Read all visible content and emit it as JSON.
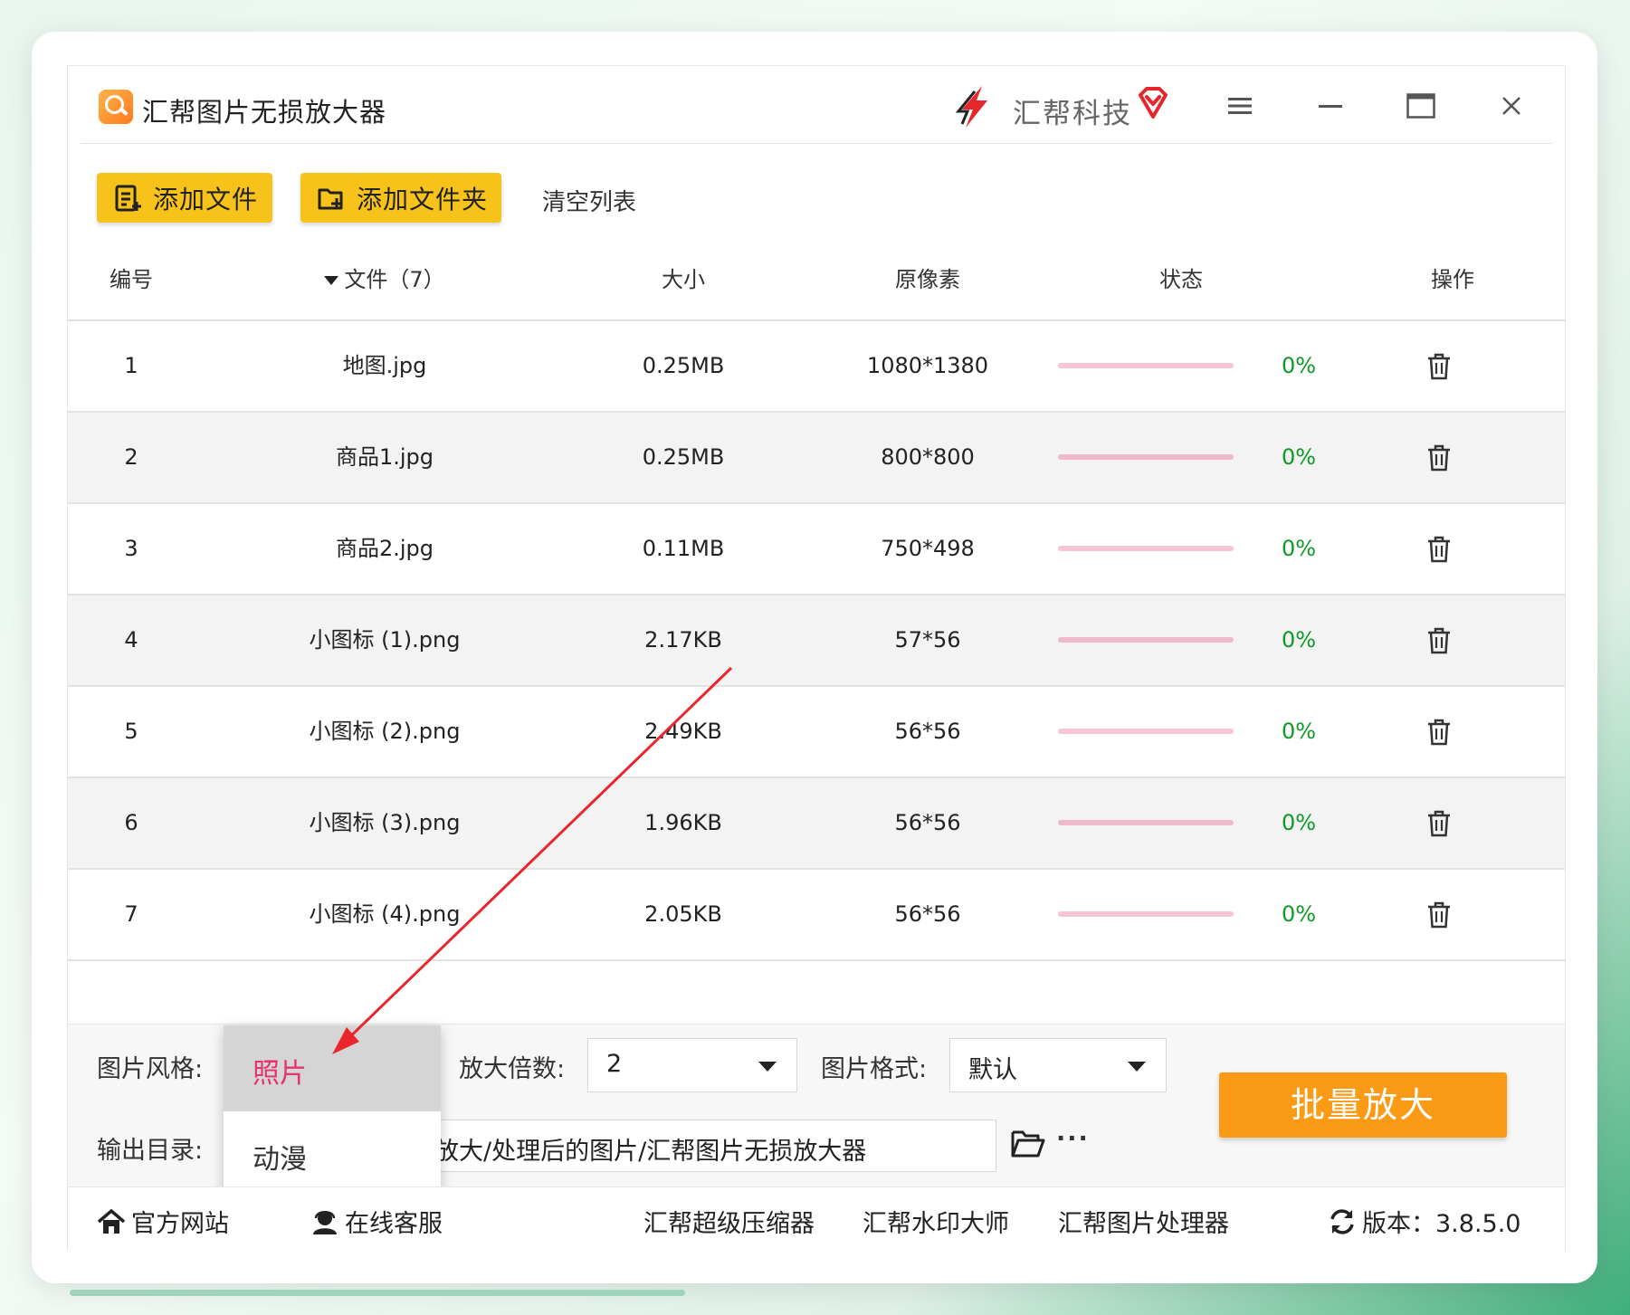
{
  "app": {
    "title": "汇帮图片无损放大器",
    "brand": "汇帮科技",
    "accent": "#f7c31a",
    "primary_button_color": "#fb9a14"
  },
  "toolbar": {
    "add_file": "添加文件",
    "add_folder": "添加文件夹",
    "clear_list": "清空列表"
  },
  "table": {
    "headers": {
      "no": "编号",
      "file": "文件（7）",
      "size": "大小",
      "pixels": "原像素",
      "status": "状态",
      "action": "操作"
    },
    "rows": [
      {
        "no": "1",
        "file": "地图.jpg",
        "size": "0.25MB",
        "pixels": "1080*1380",
        "progress": "0%"
      },
      {
        "no": "2",
        "file": "商品1.jpg",
        "size": "0.25MB",
        "pixels": "800*800",
        "progress": "0%"
      },
      {
        "no": "3",
        "file": "商品2.jpg",
        "size": "0.11MB",
        "pixels": "750*498",
        "progress": "0%"
      },
      {
        "no": "4",
        "file": "小图标 (1).png",
        "size": "2.17KB",
        "pixels": "57*56",
        "progress": "0%"
      },
      {
        "no": "5",
        "file": "小图标 (2).png",
        "size": "2.49KB",
        "pixels": "56*56",
        "progress": "0%"
      },
      {
        "no": "6",
        "file": "小图标 (3).png",
        "size": "1.96KB",
        "pixels": "56*56",
        "progress": "0%"
      },
      {
        "no": "7",
        "file": "小图标 (4).png",
        "size": "2.05KB",
        "pixels": "56*56",
        "progress": "0%"
      }
    ]
  },
  "settings": {
    "style_label": "图片风格:",
    "style_options": [
      "照片",
      "动漫"
    ],
    "style_selected": "照片",
    "scale_label": "放大倍数:",
    "scale_value": "2",
    "format_label": "图片格式:",
    "format_value": "默认",
    "output_label": "输出目录:",
    "output_value": "放大/处理后的图片/汇帮图片无损放大器",
    "more": "···",
    "batch_button": "批量放大"
  },
  "footer": {
    "website": "官方网站",
    "support": "在线客服",
    "link1": "汇帮超级压缩器",
    "link2": "汇帮水印大师",
    "link3": "汇帮图片处理器",
    "version": "版本：3.8.5.0"
  }
}
